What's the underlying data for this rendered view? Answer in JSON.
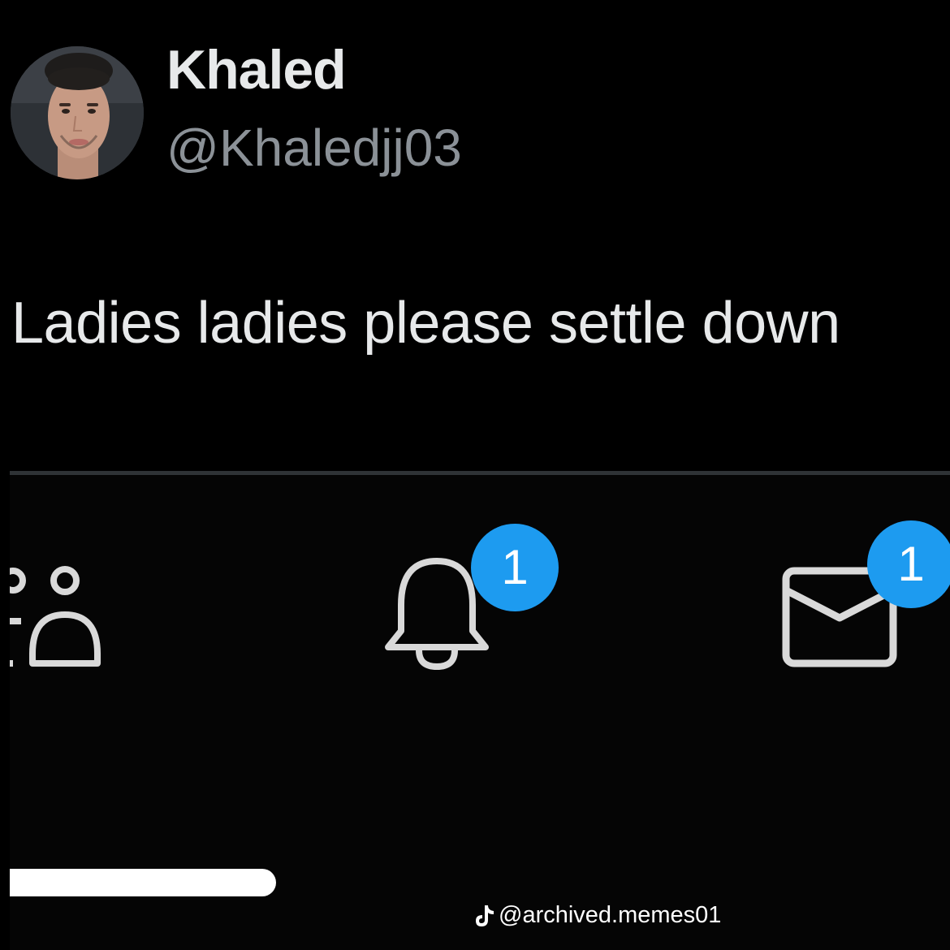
{
  "tweet": {
    "display_name": "Khaled",
    "handle": "@Khaledjj03",
    "text": "Ladies ladies please settle down"
  },
  "nav": {
    "items": [
      {
        "icon": "communities-icon",
        "badge": ""
      },
      {
        "icon": "bell-icon",
        "badge": "1"
      },
      {
        "icon": "envelope-icon",
        "badge": "1"
      }
    ]
  },
  "watermark": {
    "icon": "tiktok-icon",
    "text": "@archived.memes01"
  },
  "colors": {
    "background": "#000000",
    "badge": "#1d9bf0",
    "text": "#e7e9ea",
    "handle": "#8b9197"
  }
}
